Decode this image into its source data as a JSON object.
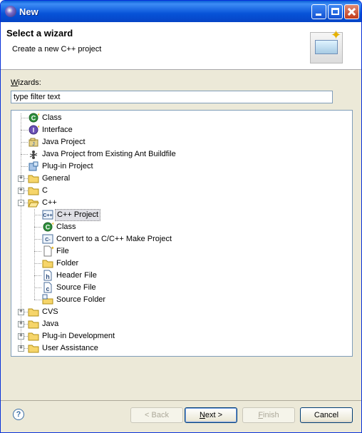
{
  "window": {
    "title": "New"
  },
  "header": {
    "title": "Select a wizard",
    "description": "Create a new C++ project"
  },
  "wizards": {
    "label_mnemonic": "W",
    "label_rest": "izards:",
    "filter_value": "type filter text"
  },
  "tree": {
    "items": [
      {
        "label": "Class",
        "icon": "class-icon"
      },
      {
        "label": "Interface",
        "icon": "interface-icon"
      },
      {
        "label": "Java Project",
        "icon": "java-project-icon"
      },
      {
        "label": "Java Project from Existing Ant Buildfile",
        "icon": "ant-icon"
      },
      {
        "label": "Plug-in Project",
        "icon": "plugin-project-icon"
      },
      {
        "label": "General",
        "icon": "folder-icon",
        "expand": "+"
      },
      {
        "label": "C",
        "icon": "folder-icon",
        "expand": "+"
      },
      {
        "label": "C++",
        "icon": "folder-open-icon",
        "expand": "-"
      },
      {
        "label": "C++ Project",
        "icon": "cpp-project-icon",
        "selected": true
      },
      {
        "label": "Class",
        "icon": "class-icon"
      },
      {
        "label": "Convert to a C/C++ Make Project",
        "icon": "convert-icon"
      },
      {
        "label": "File",
        "icon": "file-icon"
      },
      {
        "label": "Folder",
        "icon": "folder-icon"
      },
      {
        "label": "Header File",
        "icon": "header-file-icon"
      },
      {
        "label": "Source File",
        "icon": "source-file-icon"
      },
      {
        "label": "Source Folder",
        "icon": "source-folder-icon"
      },
      {
        "label": "CVS",
        "icon": "folder-icon",
        "expand": "+"
      },
      {
        "label": "Java",
        "icon": "folder-icon",
        "expand": "+"
      },
      {
        "label": "Plug-in Development",
        "icon": "folder-icon",
        "expand": "+"
      },
      {
        "label": "User Assistance",
        "icon": "folder-icon",
        "expand": "+"
      }
    ]
  },
  "buttons": {
    "back": "< Back",
    "next": "Next >",
    "finish": "Finish",
    "cancel": "Cancel",
    "help": "?"
  },
  "colors": {
    "title_bar": "#0753d8",
    "dialog_bg": "#ece9d8",
    "selection": "#dfdfe5"
  }
}
